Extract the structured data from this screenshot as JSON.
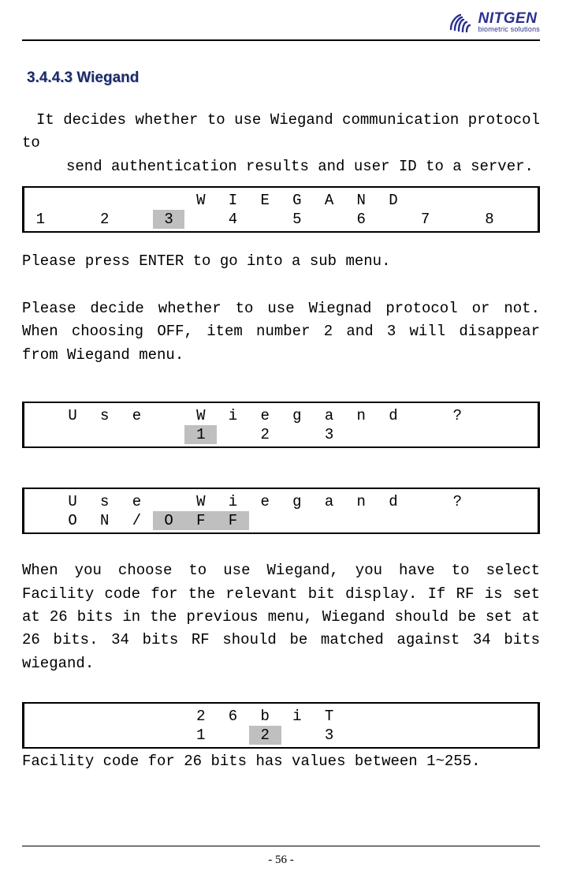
{
  "brand": {
    "name": "NITGEN",
    "tagline": "biometric solutions"
  },
  "section_title": "3.4.4.3  Wiegand",
  "p1_line1": "It decides whether to use Wiegand communication protocol to",
  "p1_line2": "send authentication results and user ID to a server.",
  "lcd_wiegand": {
    "row1": [
      "",
      "",
      "",
      "",
      "",
      "W",
      "I",
      "E",
      "G",
      "A",
      "N",
      "D",
      "",
      "",
      "",
      ""
    ],
    "row2": [
      "1",
      "",
      "2",
      "",
      "3",
      "",
      "4",
      "",
      "5",
      "",
      "6",
      "",
      "7",
      "",
      "8",
      ""
    ],
    "highlight_row2_col": 4
  },
  "p2": "Please press ENTER to go into a sub menu.",
  "p3": "Please decide whether to use Wiegnad protocol or not. When choosing OFF, item number 2 and 3 will disappear from Wiegand menu.",
  "lcd_usewiegand1": {
    "row1": [
      "",
      "U",
      "s",
      "e",
      "",
      "W",
      "i",
      "e",
      "g",
      "a",
      "n",
      "d",
      "",
      "?",
      "",
      ""
    ],
    "row2": [
      "",
      "",
      "",
      "",
      "",
      "1",
      "",
      "2",
      "",
      "3",
      "",
      "",
      "",
      "",
      "",
      ""
    ],
    "highlight_row2_col": 5
  },
  "lcd_usewiegand2": {
    "row1": [
      "",
      "U",
      "s",
      "e",
      "",
      "W",
      "i",
      "e",
      "g",
      "a",
      "n",
      "d",
      "",
      "?",
      "",
      ""
    ],
    "row2": [
      "",
      "O",
      "N",
      "/",
      "O",
      "F",
      "F",
      "",
      "",
      "",
      "",
      "",
      "",
      "",
      "",
      ""
    ],
    "highlight_row2_cols": [
      4,
      5,
      6
    ]
  },
  "p4": "When you choose to use Wiegand, you have to select Facility code for the relevant bit display. If RF is set at 26 bits in the previous menu, Wiegand should be set at 26 bits. 34 bits RF should be matched against 34 bits wiegand.",
  "lcd_26bit": {
    "row1": [
      "",
      "",
      "",
      "",
      "",
      "2",
      "6",
      "b",
      "i",
      "T",
      "",
      "",
      "",
      "",
      "",
      ""
    ],
    "row2": [
      "",
      "",
      "",
      "",
      "",
      "1",
      "",
      "2",
      "",
      "3",
      "",
      "",
      "",
      "",
      "",
      ""
    ],
    "highlight_row2_col": 7
  },
  "p5": "Facility code for 26 bits has values between 1~255.",
  "page_number": "- 56 -"
}
